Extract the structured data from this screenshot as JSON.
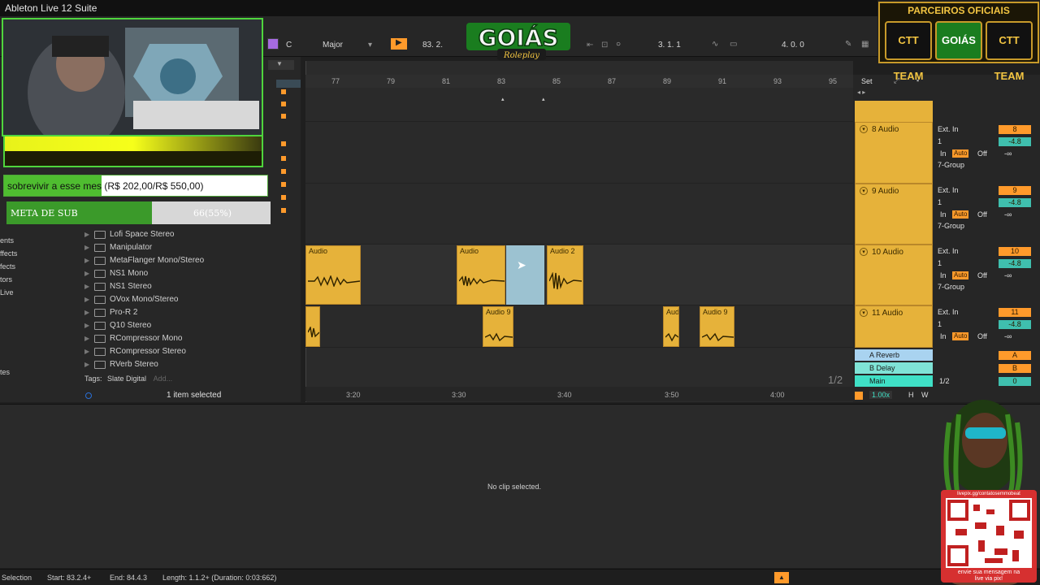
{
  "window": {
    "title": "Ableton Live 12 Suite"
  },
  "transport": {
    "key": "C",
    "scale": "Major",
    "position": "83. 2.",
    "loop_start": "3. 1. 1",
    "loop_length": "4. 0. 0"
  },
  "overlay": {
    "goal_text": "sobrevivir a esse mes (R$ 202,00/R$ 550,00)",
    "meta_label": "META DE SUB",
    "meta_value": "66(55%)",
    "meta_progress": 0.55,
    "goal_progress": 0.37,
    "brand_logo": "GOIÁS",
    "brand_sub": "Roleplay",
    "partners_title": "PARCEIROS OFICIAIS",
    "partners": [
      "CTT TEAM",
      "GOIÁS",
      "CTT TEAM"
    ],
    "qr_top": "livepix.gg/contatosemmobeat",
    "qr_bottom_1": "envie sua mensagem na",
    "qr_bottom_2": "live via pix!"
  },
  "browser": {
    "side_items": [
      "ents",
      "ffects",
      "fects",
      "tors",
      "Live",
      "tes"
    ],
    "items": [
      {
        "label": "Lofi Space Stereo"
      },
      {
        "label": "Manipulator"
      },
      {
        "label": "MetaFlanger Mono/Stereo"
      },
      {
        "label": "NS1 Mono"
      },
      {
        "label": "NS1 Stereo"
      },
      {
        "label": "OVox Mono/Stereo"
      },
      {
        "label": "Pro-R 2"
      },
      {
        "label": "Q10 Stereo"
      },
      {
        "label": "RCompressor Mono"
      },
      {
        "label": "RCompressor Stereo"
      },
      {
        "label": "RVerb Stereo"
      }
    ],
    "tags_label": "Tags:",
    "tags_value": "Slate Digital",
    "tags_add": "Add...",
    "status": "1 item selected"
  },
  "arrangement": {
    "bars": [
      "77",
      "79",
      "81",
      "83",
      "85",
      "87",
      "89",
      "91",
      "93",
      "95"
    ],
    "times": [
      "3:20",
      "3:30",
      "3:40",
      "3:50",
      "4:00"
    ],
    "page": "1/2",
    "zoom": "1.00x",
    "clips": [
      {
        "name": "Audio"
      },
      {
        "name": "Audio"
      },
      {
        "name": "Audio 2"
      },
      {
        "name": ""
      },
      {
        "name": "Audio 9"
      },
      {
        "name": "Audi"
      },
      {
        "name": "Audio 9"
      }
    ]
  },
  "mixer": {
    "set_label": "Set",
    "ext_in": "Ext. In",
    "channel": "1",
    "in_label": "In",
    "auto_label": "Auto",
    "off_label": "Off",
    "group": "7-Group",
    "inf": "-∞",
    "tracks": [
      {
        "name": "8 Audio",
        "num": "8",
        "vol": "-4.8"
      },
      {
        "name": "9 Audio",
        "num": "9",
        "vol": "-4.8"
      },
      {
        "name": "10 Audio",
        "num": "10",
        "vol": "-4.8"
      },
      {
        "name": "11 Audio",
        "num": "11",
        "vol": "-4.8"
      }
    ],
    "returns": [
      {
        "name": "A Reverb",
        "tag": "A",
        "color": "#a9d3f0"
      },
      {
        "name": "B Delay",
        "tag": "B",
        "color": "#7fe3d6"
      },
      {
        "name": "Main",
        "tag": "0",
        "color": "#3fe0c6"
      }
    ],
    "main_out": "1/2",
    "H": "H",
    "W": "W"
  },
  "detail": {
    "empty_text": "No clip selected."
  },
  "status": {
    "mode": "Selection",
    "start": "Start: 83.2.4+",
    "end": "End: 84.4.3",
    "length": "Length: 1.1.2+ (Duration: 0:03:662)"
  },
  "colors": {
    "clip": "#e6b23a",
    "accent": "#ff9a2b",
    "selection": "#a9d3e3",
    "overlay_green": "#4fd53d"
  }
}
